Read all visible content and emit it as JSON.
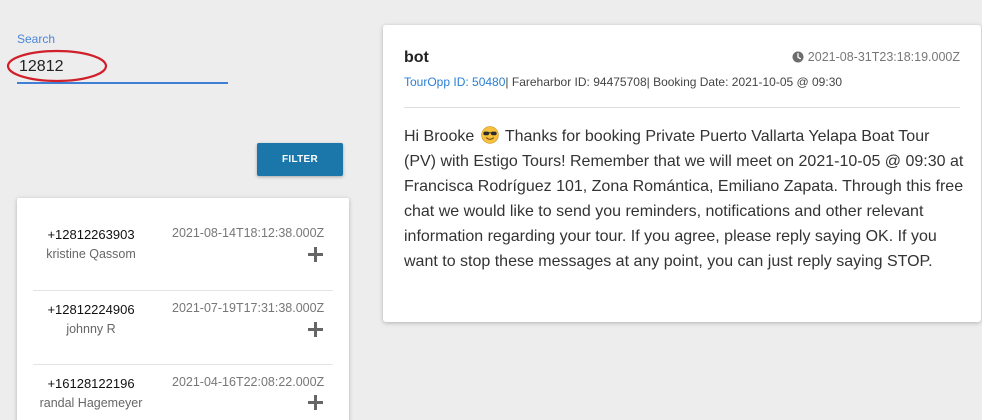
{
  "search": {
    "label": "Search",
    "value": "12812"
  },
  "filter_button": {
    "label": "FILTER"
  },
  "conversations": [
    {
      "phone": "+12812263903",
      "name": "kristine Qassom",
      "date": "2021-08-14T18:12:38.000Z"
    },
    {
      "phone": "+12812224906",
      "name": "johnny R",
      "date": "2021-07-19T17:31:38.000Z"
    },
    {
      "phone": "+16128122196",
      "name": "randal Hagemeyer",
      "date": "2021-04-16T22:08:22.000Z"
    }
  ],
  "message": {
    "sender": "bot",
    "timestamp": "2021-08-31T23:18:19.000Z",
    "tour_opp": "TourOpp ID: 50480",
    "meta_rest": "| Fareharbor ID: 94475708| Booking Date: 2021-10-05 @ 09:30",
    "body_greeting": "Hi Brooke",
    "body_emoji": "smiling-face-with-sunglasses-icon",
    "body_rest": " Thanks for booking Private Puerto Vallarta Yelapa Boat Tour (PV) with Estigo Tours! Remember that we will meet on 2021-10-05 @ 09:30 at Francisca Rodríguez 101, Zona Romántica, Emiliano Zapata. Through this free chat we would like to send you reminders, notifications and other relevant information regarding your tour. If you agree, please reply saying OK. If you want to stop these messages at any point, you can just reply saying STOP."
  },
  "colors": {
    "background": "#ededed",
    "accent_blue": "#3f7fd6",
    "filter_button": "#1b76a9",
    "annotation_red": "#d0202a"
  }
}
